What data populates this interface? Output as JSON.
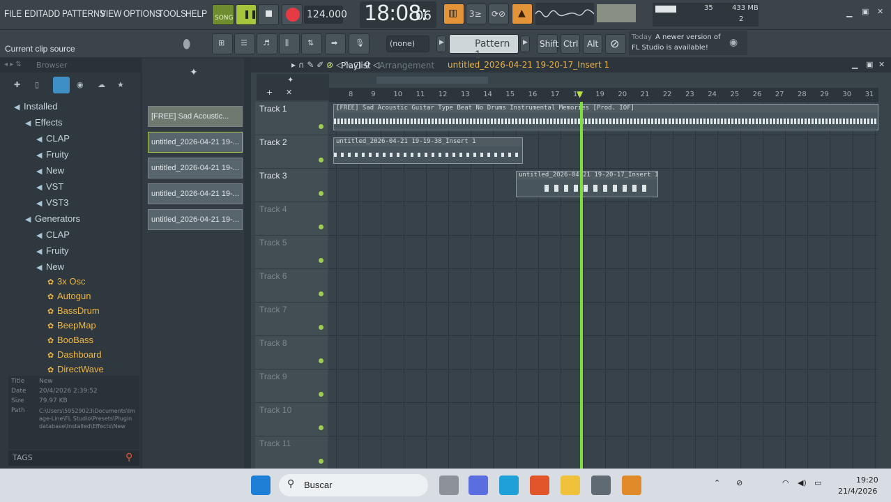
{
  "menu": [
    "FILE",
    "EDIT",
    "ADD",
    "PATTERNS",
    "VIEW",
    "OPTIONS",
    "TOOLS",
    "HELP"
  ],
  "transport": {
    "mode": "SONG",
    "tempo": "124.000",
    "clock_main": "18:08:",
    "clock_sub": "06"
  },
  "monitor": {
    "cpu": "35",
    "memory": "433 MB",
    "voices": "2"
  },
  "hint": {
    "title": "Current clip source"
  },
  "pattern_selector": {
    "none_label": "(none)",
    "pattern": "Pattern 1"
  },
  "modifiers": [
    "Shift",
    "Ctrl",
    "Alt"
  ],
  "news": {
    "label": "Today",
    "text1": "A newer version of",
    "text2": "FL Studio is available!"
  },
  "browser": {
    "title": "Browser",
    "items": [
      {
        "label": "Installed",
        "level": 0,
        "icon": "folder"
      },
      {
        "label": "Effects",
        "level": 1,
        "icon": "folder"
      },
      {
        "label": "CLAP",
        "level": 2,
        "icon": "folder"
      },
      {
        "label": "Fruity",
        "level": 2,
        "icon": "folder"
      },
      {
        "label": "New",
        "level": 2,
        "icon": "folder"
      },
      {
        "label": "VST",
        "level": 2,
        "icon": "folder"
      },
      {
        "label": "VST3",
        "level": 2,
        "icon": "folder"
      },
      {
        "label": "Generators",
        "level": 1,
        "icon": "folder"
      },
      {
        "label": "CLAP",
        "level": 2,
        "icon": "folder"
      },
      {
        "label": "Fruity",
        "level": 2,
        "icon": "folder"
      },
      {
        "label": "New",
        "level": 2,
        "icon": "folder"
      },
      {
        "label": "3x Osc",
        "level": 3,
        "icon": "gear"
      },
      {
        "label": "Autogun",
        "level": 3,
        "icon": "gear"
      },
      {
        "label": "BassDrum",
        "level": 3,
        "icon": "gear"
      },
      {
        "label": "BeepMap",
        "level": 3,
        "icon": "gear"
      },
      {
        "label": "BooBass",
        "level": 3,
        "icon": "gear"
      },
      {
        "label": "Dashboard",
        "level": 3,
        "icon": "gear"
      },
      {
        "label": "DirectWave",
        "level": 3,
        "icon": "gear"
      }
    ],
    "info": {
      "title_label": "Title",
      "title": "New",
      "date_label": "Date",
      "date": "20/4/2026 2:39:52",
      "size_label": "Size",
      "size": "79.97 KB",
      "path_label": "Path",
      "path": "C:\\Users\\59529023\\Documents\\Image-Line\\FL Studio\\Presets\\Plugin database\\Installed\\Effects\\New"
    },
    "tags_label": "TAGS"
  },
  "clips": [
    "[FREE] Sad Acoustic...",
    "untitled_2026-04-21 19-...",
    "untitled_2026-04-21 19-...",
    "untitled_2026-04-21 19-...",
    "untitled_2026-04-21 19-..."
  ],
  "playlist": {
    "title": "Playlist",
    "arrangement": "Arrangement",
    "current_clip": "untitled_2026-04-21 19-20-17_Insert 1",
    "ruler": [
      "8",
      "9",
      "10",
      "11",
      "12",
      "13",
      "14",
      "15",
      "16",
      "17",
      "18",
      "19",
      "20",
      "21",
      "22",
      "23",
      "24",
      "25",
      "26",
      "27",
      "28",
      "29",
      "30",
      "31"
    ],
    "tracks": [
      "Track 1",
      "Track 2",
      "Track 3",
      "Track 4",
      "Track 5",
      "Track 6",
      "Track 7",
      "Track 8",
      "Track 9",
      "Track 10",
      "Track 11"
    ],
    "patterns": [
      {
        "label": "[FREE] Sad Acoustic Guitar Type Beat No Drums  Instrumental  Memories [Prod. IOF]"
      },
      {
        "label": "untitled_2026-04-21 19-19-38_Insert 1"
      },
      {
        "label": "untitled_2026-04-21 19-20-17_Insert 1"
      }
    ]
  },
  "taskbar": {
    "search": "Buscar",
    "time": "19:20",
    "date": "21/4/2026"
  }
}
